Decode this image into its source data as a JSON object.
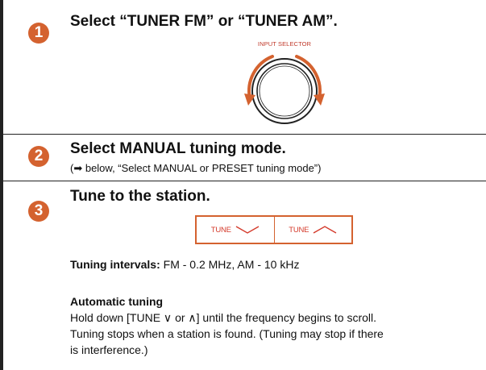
{
  "step1": {
    "number": "1",
    "title": "Select “TUNER FM” or “TUNER AM”.",
    "knob_label": "INPUT SELECTOR"
  },
  "step2": {
    "number": "2",
    "title": "Select MANUAL tuning mode.",
    "note": "(➡ below, “Select MANUAL or PRESET tuning mode”)"
  },
  "step3": {
    "number": "3",
    "title": "Tune to the station.",
    "tune_down_label": "TUNE",
    "tune_up_label": "TUNE",
    "intervals_label": "Tuning intervals:",
    "intervals_value": " FM - 0.2 MHz, AM - 10 kHz",
    "auto_heading": "Automatic tuning",
    "auto_line1": "Hold down [TUNE ∨ or ∧] until the frequency begins to scroll.",
    "auto_line2": "Tuning stops when a station is found. (Tuning may stop if there",
    "auto_line3": "is interference.)"
  },
  "colors": {
    "accent": "#d4622f",
    "label_red": "#c03a2b"
  },
  "icons": {
    "knob": "input-selector-knob-icon",
    "tune_down": "chevron-down-icon",
    "tune_up": "chevron-up-icon"
  }
}
